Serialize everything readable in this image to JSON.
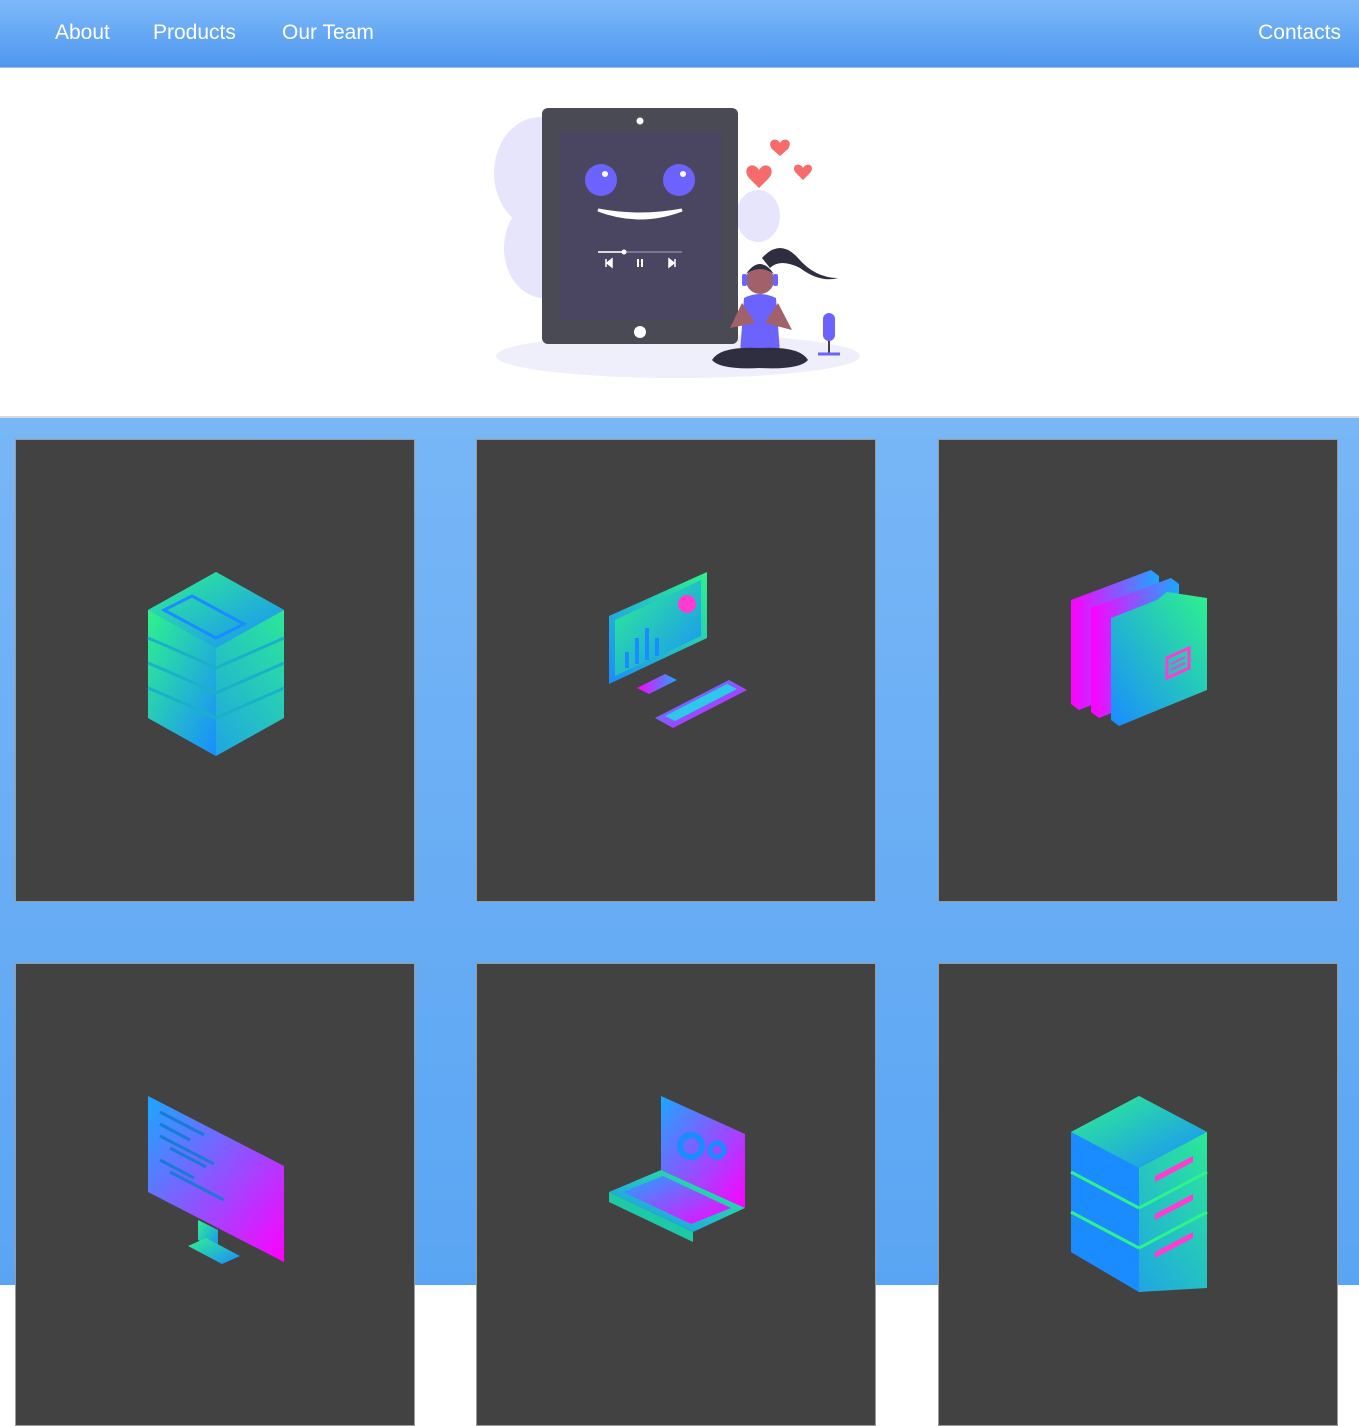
{
  "nav": {
    "about": "About",
    "products": "Products",
    "our_team": "Our Team",
    "contacts": "Contacts"
  },
  "colors": {
    "nav_gradient_top": "#7db9f8",
    "nav_gradient_bottom": "#4e97ef",
    "gallery_background": "#6aaef6",
    "card_background": "#424242",
    "icon_gradient_green": "#2ef28c",
    "icon_gradient_blue": "#1a8cff",
    "icon_gradient_magenta": "#ff00ff"
  },
  "hero": {
    "illustration": "tablet-music-meditation-illustration"
  },
  "cards": [
    {
      "icon": "database-stack-icon"
    },
    {
      "icon": "desktop-analytics-icon"
    },
    {
      "icon": "folders-icon"
    },
    {
      "icon": "code-monitor-icon"
    },
    {
      "icon": "laptop-settings-icon"
    },
    {
      "icon": "server-rack-icon"
    }
  ]
}
